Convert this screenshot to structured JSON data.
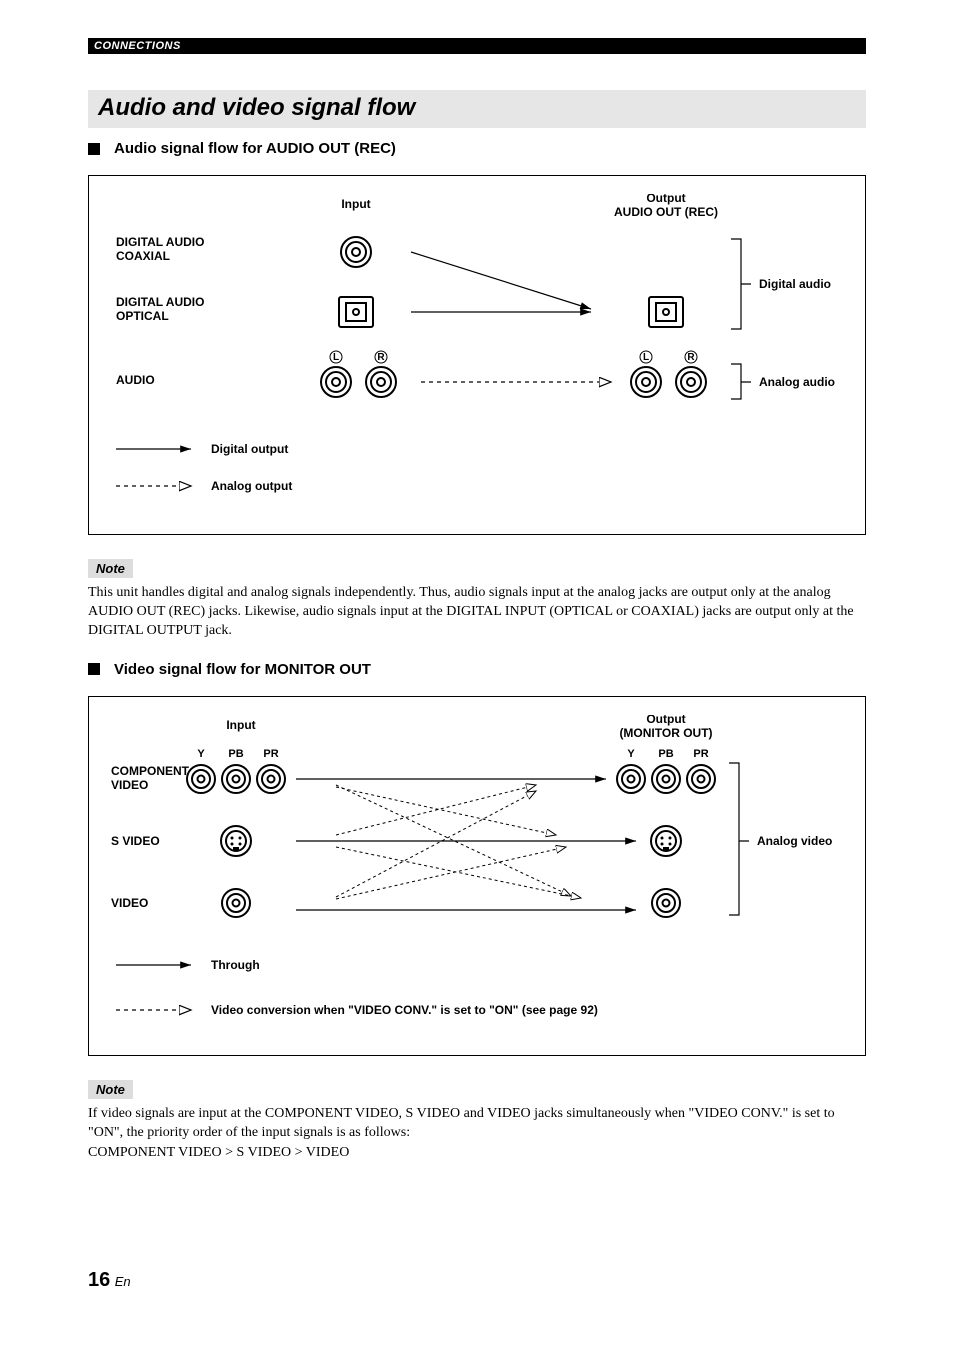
{
  "header": {
    "section_label": "CONNECTIONS"
  },
  "title": "Audio and video signal flow",
  "audio": {
    "subhead": "Audio signal flow for AUDIO OUT (REC)",
    "col_input": "Input",
    "col_output_l1": "Output",
    "col_output_l2": "AUDIO OUT (REC)",
    "rows": {
      "digital_coax_l1": "DIGITAL AUDIO",
      "digital_coax_l2": "COAXIAL",
      "digital_opt_l1": "DIGITAL AUDIO",
      "digital_opt_l2": "OPTICAL",
      "audio": "AUDIO"
    },
    "out_digital": "Digital audio",
    "out_analog": "Analog audio",
    "legend_digital": "Digital output",
    "legend_analog": "Analog output",
    "lr": {
      "L": "L",
      "R": "R"
    }
  },
  "note1": {
    "label": "Note",
    "text": "This unit handles digital and analog signals independently. Thus, audio signals input at the analog jacks are output only at the analog AUDIO OUT (REC) jacks. Likewise, audio signals input at the DIGITAL INPUT (OPTICAL or COAXIAL) jacks are output only at the DIGITAL OUTPUT jack."
  },
  "video": {
    "subhead": "Video signal flow for MONITOR OUT",
    "col_input": "Input",
    "col_output_l1": "Output",
    "col_output_l2": "(MONITOR OUT)",
    "rows": {
      "component_l1": "COMPONENT",
      "component_l2": "VIDEO",
      "svideo": "S VIDEO",
      "video": "VIDEO"
    },
    "labels": {
      "Y": "Y",
      "PB": "PB",
      "PR": "PR"
    },
    "out_analog": "Analog video",
    "legend_through": "Through",
    "legend_conv": "Video conversion when \"VIDEO CONV.\" is set to \"ON\" (see page 92)"
  },
  "note2": {
    "label": "Note",
    "text_l1": "If video signals are input at the COMPONENT VIDEO, S VIDEO and VIDEO jacks simultaneously when \"VIDEO CONV.\" is set to \"ON\", the priority order of the input signals is as follows:",
    "text_l2": "COMPONENT VIDEO > S VIDEO > VIDEO"
  },
  "footer": {
    "page": "16",
    "lang": "En"
  },
  "chart_data": [
    {
      "type": "diagram",
      "title": "Audio signal flow for AUDIO OUT (REC)",
      "nodes": [
        {
          "id": "in_coax",
          "label": "DIGITAL AUDIO COAXIAL",
          "side": "input"
        },
        {
          "id": "in_opt",
          "label": "DIGITAL AUDIO OPTICAL",
          "side": "input"
        },
        {
          "id": "in_analog",
          "label": "AUDIO (L/R)",
          "side": "input"
        },
        {
          "id": "out_opt",
          "label": "Digital audio (OPTICAL)",
          "side": "output"
        },
        {
          "id": "out_analog",
          "label": "Analog audio (L/R)",
          "side": "output"
        }
      ],
      "edges": [
        {
          "from": "in_coax",
          "to": "out_opt",
          "style": "solid",
          "meaning": "Digital output"
        },
        {
          "from": "in_opt",
          "to": "out_opt",
          "style": "solid",
          "meaning": "Digital output"
        },
        {
          "from": "in_analog",
          "to": "out_analog",
          "style": "dashed",
          "meaning": "Analog output"
        }
      ]
    },
    {
      "type": "diagram",
      "title": "Video signal flow for MONITOR OUT",
      "nodes": [
        {
          "id": "in_component",
          "label": "COMPONENT VIDEO (Y/PB/PR)",
          "side": "input"
        },
        {
          "id": "in_svideo",
          "label": "S VIDEO",
          "side": "input"
        },
        {
          "id": "in_video",
          "label": "VIDEO",
          "side": "input"
        },
        {
          "id": "out_component",
          "label": "COMPONENT VIDEO (Y/PB/PR)",
          "side": "output"
        },
        {
          "id": "out_svideo",
          "label": "S VIDEO",
          "side": "output"
        },
        {
          "id": "out_video",
          "label": "VIDEO",
          "side": "output"
        }
      ],
      "edges": [
        {
          "from": "in_component",
          "to": "out_component",
          "style": "solid",
          "meaning": "Through"
        },
        {
          "from": "in_svideo",
          "to": "out_svideo",
          "style": "solid",
          "meaning": "Through"
        },
        {
          "from": "in_video",
          "to": "out_video",
          "style": "solid",
          "meaning": "Through"
        },
        {
          "from": "in_svideo",
          "to": "out_component",
          "style": "dashed",
          "meaning": "Video conversion when VIDEO CONV. is ON"
        },
        {
          "from": "in_video",
          "to": "out_component",
          "style": "dashed",
          "meaning": "Video conversion when VIDEO CONV. is ON"
        },
        {
          "from": "in_video",
          "to": "out_svideo",
          "style": "dashed",
          "meaning": "Video conversion when VIDEO CONV. is ON"
        },
        {
          "from": "in_component",
          "to": "out_svideo",
          "style": "dashed",
          "meaning": "Video conversion when VIDEO CONV. is ON"
        },
        {
          "from": "in_component",
          "to": "out_video",
          "style": "dashed",
          "meaning": "Video conversion when VIDEO CONV. is ON"
        },
        {
          "from": "in_svideo",
          "to": "out_video",
          "style": "dashed",
          "meaning": "Video conversion when VIDEO CONV. is ON"
        }
      ]
    }
  ]
}
